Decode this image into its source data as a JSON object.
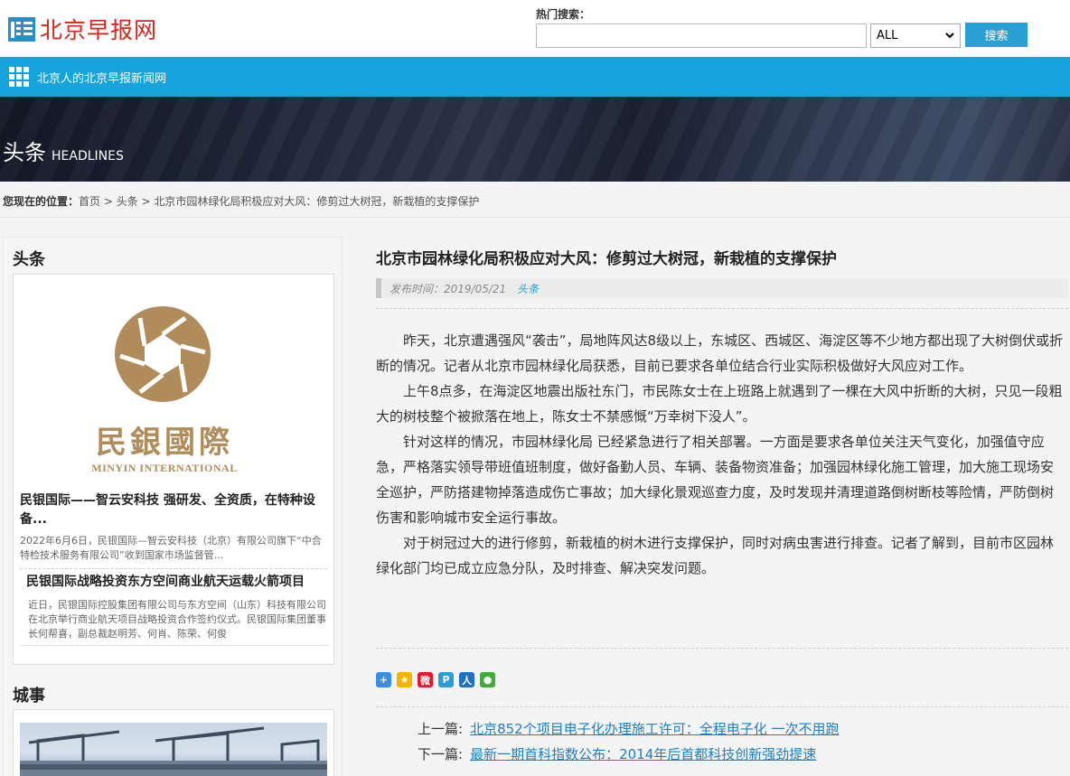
{
  "header": {
    "logo_text": "北京早报网",
    "hot_search_label": "热门搜索：",
    "search_value": "",
    "search_select_value": "ALL",
    "search_button": "搜索"
  },
  "nav": {
    "site_name": "北京人的北京早报新闻网"
  },
  "banner": {
    "title_cn": "头条",
    "title_en": "HEADLINES"
  },
  "breadcrumb": {
    "label": "您现在的位置：",
    "home": "首页",
    "sep": " > ",
    "section": "头条",
    "current": "北京市园林绿化局积极应对大风：修剪过大树冠，新栽植的支撑保护"
  },
  "sidebar": {
    "section1_title": "头条",
    "logo_cn": "民銀國際",
    "logo_en": "MINYIN INTERNATIONAL",
    "item1_title": "民银国际——智云安科技 强研发、全资质，在特种设备...",
    "item1_desc": "2022年6月6日，民银国际—智云安科技（北京）有限公司旗下“中合特检技术服务有限公司”收到国家市场监督管...",
    "item2_title": "民银国际战略投资东方空间商业航天运载火箭项目",
    "item2_desc": "近日，民银国际控股集团有限公司与东方空间（山东）科技有限公司在北京举行商业航天项目战略投资合作签约仪式。民银国际集团董事长何帮喜，副总裁赵明芳、何肖、陈荣、何俊",
    "section2_title": "城事"
  },
  "article": {
    "title": "北京市园林绿化局积极应对大风：修剪过大树冠，新栽植的支撑保护",
    "publish_label": "发布时间：2019/05/21",
    "category": "头条",
    "paragraphs": [
      "昨天，北京遭遇强风“袭击”，局地阵风达8级以上，东城区、西城区、海淀区等不少地方都出现了大树倒伏或折断的情况。记者从北京市园林绿化局获悉，目前已要求各单位结合行业实际积极做好大风应对工作。",
      "上午8点多，在海淀区地震出版社东门，市民陈女士在上班路上就遇到了一棵在大风中折断的大树，只见一段粗大的树枝整个被掀落在地上，陈女士不禁感慨“万幸树下没人”。",
      "针对这样的情况，市园林绿化局 已经紧急进行了相关部署。一方面是要求各单位关注天气变化，加强值守应急，严格落实领导带班值班制度，做好备勤人员、车辆、装备物资准备；加强园林绿化施工管理，加大施工现场安全巡护，严防搭建物掉落造成伤亡事故；加大绿化景观巡查力度，及时发现并清理道路倒树断枝等险情，严防倒树伤害和影响城市安全运行事故。",
      "对于树冠过大的进行修剪，新栽植的树木进行支撑保护，同时对病虫害进行排查。记者了解到，目前市区园林绿化部门均已成立应急分队，及时排查、解决突发问题。"
    ],
    "share_icons": [
      "share-more-icon",
      "qzone-icon",
      "weibo-icon",
      "tencent-weibo-icon",
      "renren-icon",
      "wechat-icon"
    ],
    "prev_label": "上一篇:",
    "prev_link": "北京852个项目电子化办理施工许可：全程电子化 一次不用跑",
    "next_label": "下一篇:",
    "next_link": "最新一期首科指数公布：2014年后首都科技创新强劲提速"
  },
  "colors": {
    "nav_bg": "#16a4dd",
    "brand_red": "#d9261c",
    "link_blue": "#1d7fc4",
    "logo_gold": "#b08c5a"
  }
}
